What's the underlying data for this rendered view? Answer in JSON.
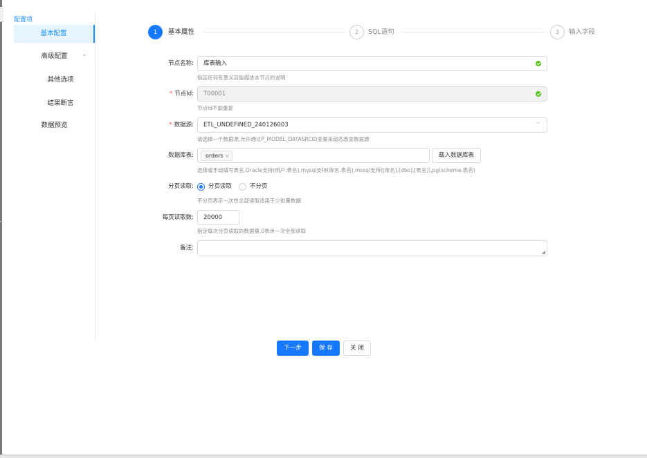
{
  "sidebar": {
    "title": "配置项",
    "items": [
      {
        "label": "基本配置"
      },
      {
        "label": "高级配置",
        "caret": "⌃"
      },
      {
        "label": "其他选项"
      },
      {
        "label": "结果断言"
      },
      {
        "label": "数据预览"
      }
    ]
  },
  "steps": [
    {
      "number": "1",
      "label": "基本属性",
      "status": "active"
    },
    {
      "number": "2",
      "label": "SQL语句",
      "status": "wait"
    },
    {
      "number": "3",
      "label": "输入字段",
      "status": "wait"
    }
  ],
  "form": {
    "node_name": {
      "label": "节点名称:",
      "value": "库表输入",
      "help": "指定任何有意义且能描述本节点的说明"
    },
    "node_id": {
      "required": "*",
      "label": "节点Id:",
      "value": "T00001",
      "help": "节点Id不能重复"
    },
    "datasource": {
      "required": "*",
      "label": "数据源:",
      "value": "ETL_UNDEFINED_240126003",
      "help": "请选择一个数据源,允许通过P_MODEL_DATASRCID变量来动态改变数据源"
    },
    "table": {
      "label": "数据库表:",
      "tag": "orders",
      "tag_close": "×",
      "load_button": "载入数据库表",
      "help": "选择或手动填写表名,Oracle支持(用户.表名),mysql支持(库名.表名),mssql支持([库名].[dbo].[表名]),pg(schema.表名)"
    },
    "paging": {
      "label": "分页读取:",
      "options": [
        "分页读取",
        "不分页"
      ],
      "selected": "分页读取",
      "help": "不分页表示一次性全部读取适用于少批量数据"
    },
    "page_size": {
      "label": "每页读取数:",
      "value": "20000",
      "help": "指定每次分页读取的数据量,0表示一次全部读取"
    },
    "remark": {
      "label": "备注:",
      "value": ""
    }
  },
  "buttons": {
    "next": "下一步",
    "save": "保 存",
    "close": "关 闭"
  },
  "colors": {
    "primary": "#1677ff",
    "success": "#52c41a",
    "required": "#ff4d4f"
  }
}
